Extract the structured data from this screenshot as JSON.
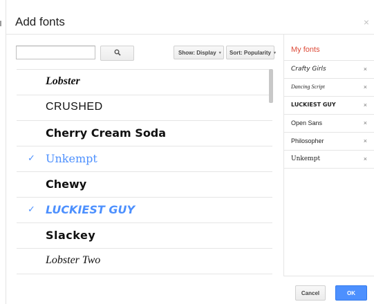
{
  "dialog": {
    "title": "Add fonts",
    "close_label": "×"
  },
  "toolbar": {
    "search": {
      "value": "",
      "placeholder": ""
    },
    "search_icon": "magnifier-icon",
    "show_label": "Show: Display",
    "sort_label": "Sort: Popularity",
    "caret": "▾"
  },
  "font_list": [
    {
      "name": "Lobster",
      "selected": false
    },
    {
      "name": "CRUSHED",
      "selected": false
    },
    {
      "name": "Cherry Cream Soda",
      "selected": false
    },
    {
      "name": "Unkempt",
      "selected": true
    },
    {
      "name": "Chewy",
      "selected": false
    },
    {
      "name": "LUCKIEST GUY",
      "selected": true
    },
    {
      "name": "Slackey",
      "selected": false
    },
    {
      "name": "Lobster Two",
      "selected": false
    }
  ],
  "check_glyph": "✓",
  "my_fonts": {
    "title": "My fonts",
    "items": [
      {
        "name": "Crafty Girls",
        "remove": "×"
      },
      {
        "name": "Dancing Script",
        "remove": "×"
      },
      {
        "name": "LUCKIEST GUY",
        "remove": "×"
      },
      {
        "name": "Open Sans",
        "remove": "×"
      },
      {
        "name": "Philosopher",
        "remove": "×"
      },
      {
        "name": "Unkempt",
        "remove": "×"
      }
    ]
  },
  "footer": {
    "cancel_label": "Cancel",
    "ok_label": "OK"
  },
  "colors": {
    "accent": "#4d90fe",
    "my_fonts_title": "#dd4b39"
  }
}
